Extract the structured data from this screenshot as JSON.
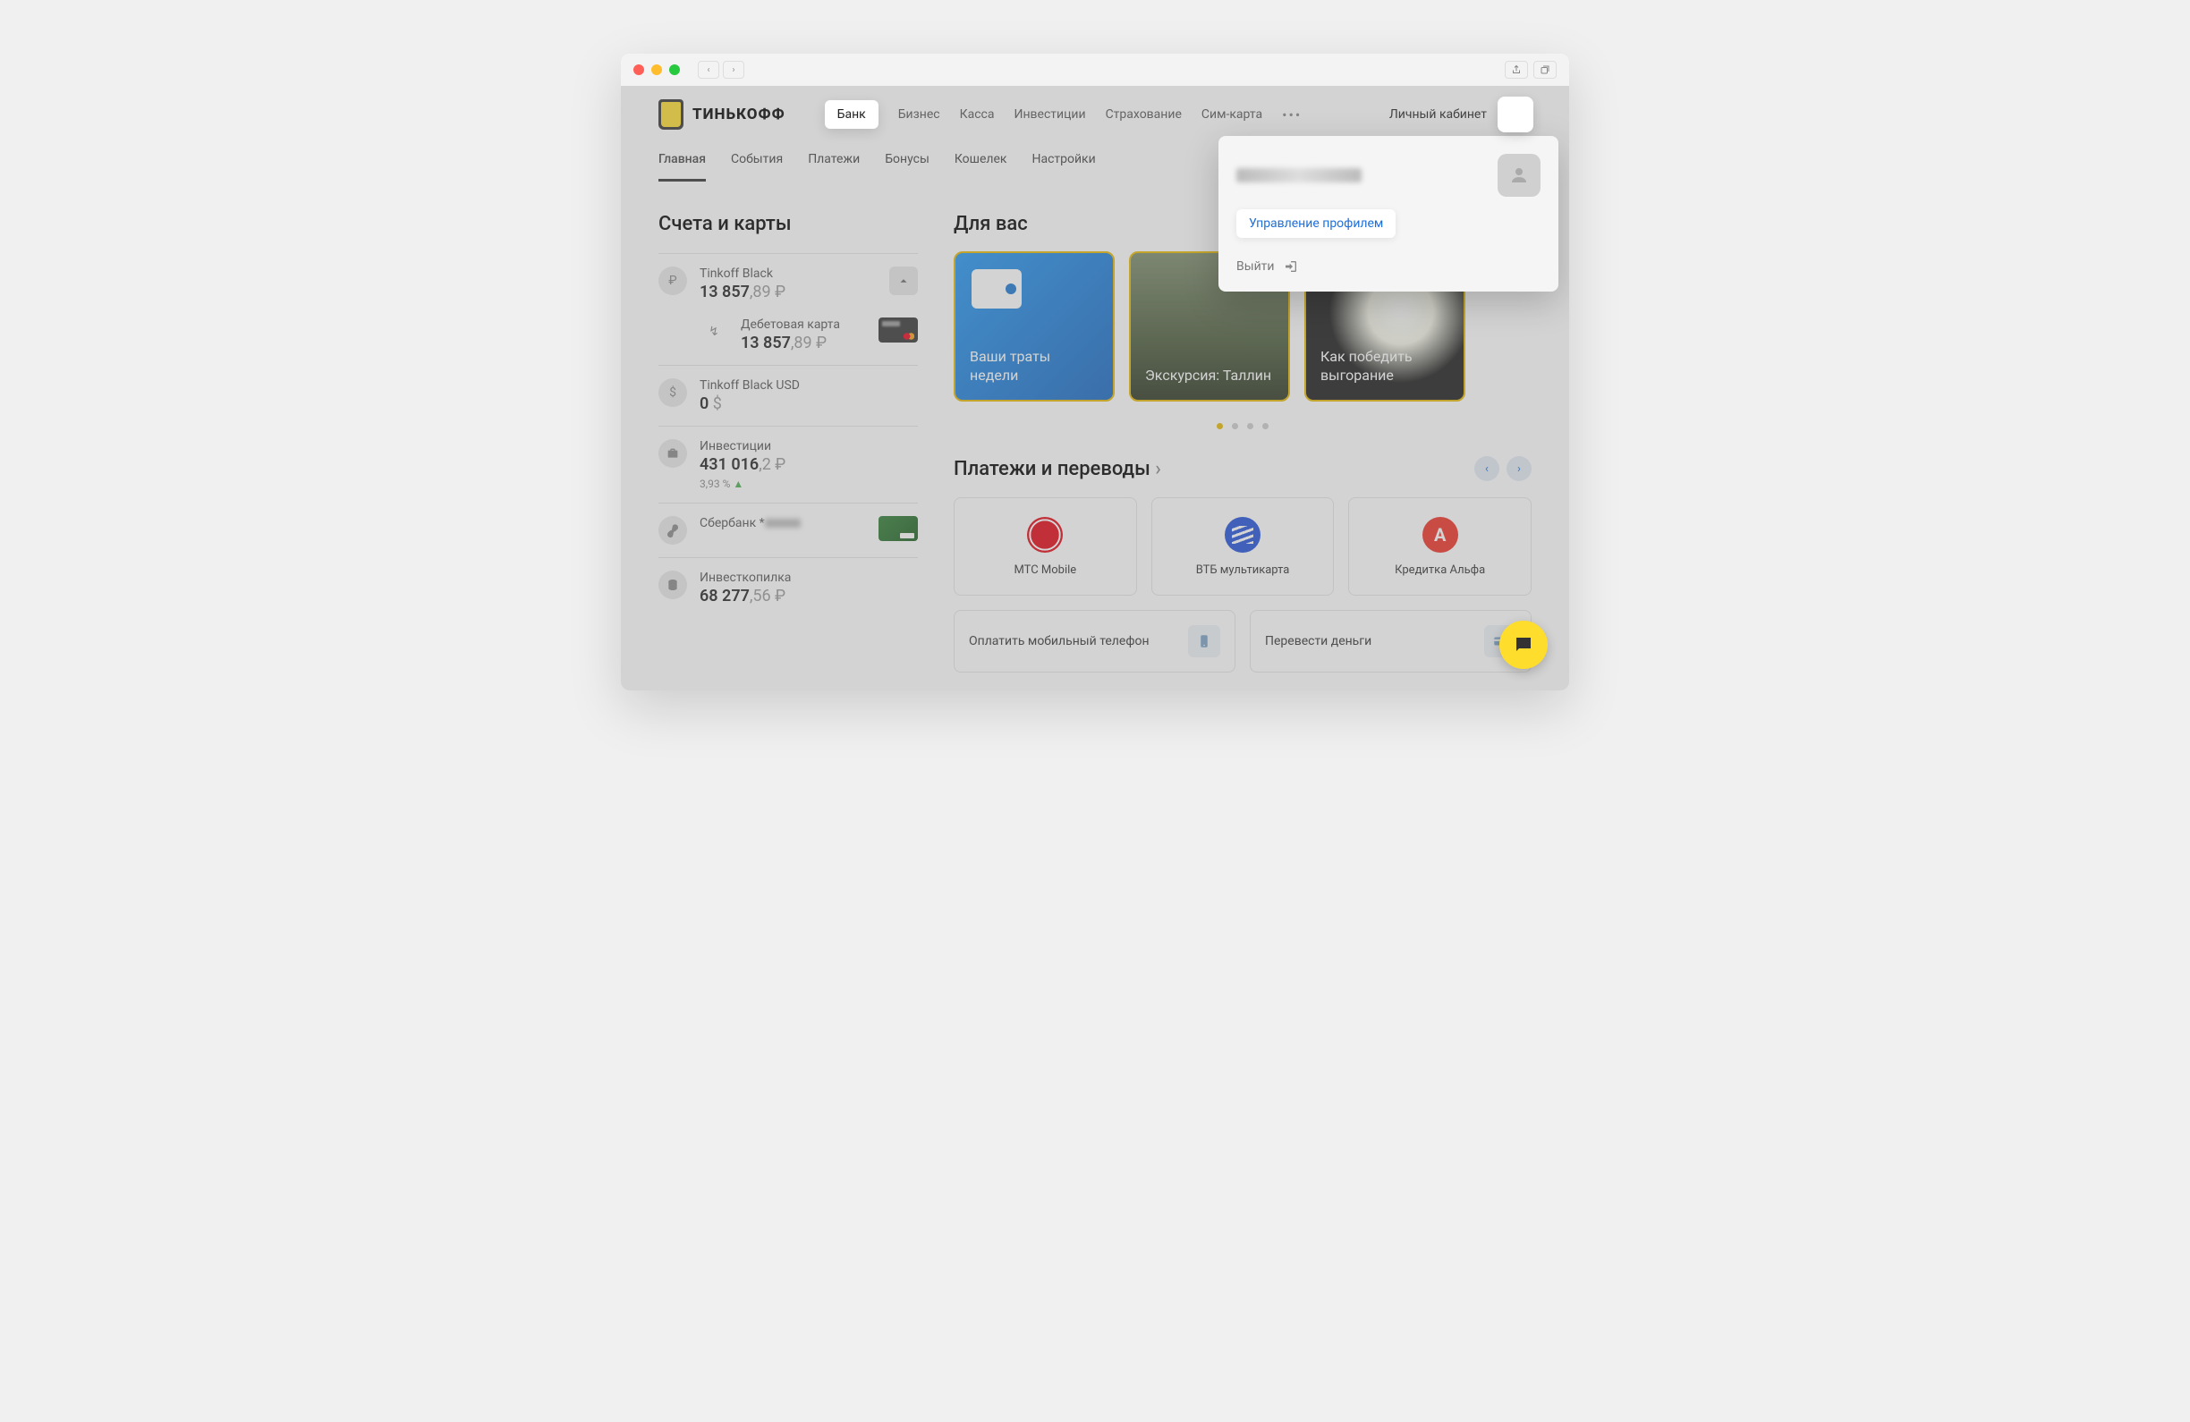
{
  "brand": "ТИНЬКОФФ",
  "top_nav": {
    "items": [
      "Банк",
      "Бизнес",
      "Касса",
      "Инвестиции",
      "Страхование",
      "Сим-карта"
    ],
    "active_index": 0
  },
  "cabinet_label": "Личный кабинет",
  "sub_nav": {
    "items": [
      "Главная",
      "События",
      "Платежи",
      "Бонусы",
      "Кошелек",
      "Настройки"
    ],
    "active_index": 0
  },
  "profile_menu": {
    "manage_label": "Управление профилем",
    "logout_label": "Выйти"
  },
  "sidebar": {
    "title": "Счета и карты",
    "accounts": [
      {
        "name": "Tinkoff Black",
        "amount_int": "13 857",
        "amount_cents": ",89 ₽",
        "icon": "₽",
        "has_collapse": true,
        "sub": {
          "name": "Дебетовая карта",
          "amount_int": "13 857",
          "amount_cents": ",89 ₽",
          "icon": "↯",
          "card_style": "black"
        }
      },
      {
        "name": "Tinkoff Black USD",
        "amount_int": "0",
        "amount_cents": " $",
        "icon": "$"
      },
      {
        "name": "Инвестиции",
        "amount_int": "431 016",
        "amount_cents": ",2 ₽",
        "icon": "briefcase",
        "growth": "3,93 %"
      },
      {
        "name": "Сбербанк *",
        "amount_int": "",
        "amount_cents": "",
        "icon": "link",
        "card_style": "visa",
        "masked_tail": true
      },
      {
        "name": "Инвесткопилка",
        "amount_int": "68 277",
        "amount_cents": ",56 ₽",
        "icon": "stack"
      }
    ]
  },
  "for_you": {
    "title": "Для вас",
    "cards": [
      {
        "title": "Ваши траты недели",
        "style": "blue"
      },
      {
        "title": "Экскурсия: Таллин",
        "style": "city"
      },
      {
        "title": "Как победить выгорание",
        "style": "flower"
      }
    ],
    "dot_count": 4,
    "dot_active": 0
  },
  "payments": {
    "title": "Платежи и переводы",
    "providers": [
      {
        "label": "МТС Mobile",
        "logo": "mts"
      },
      {
        "label": "ВТБ мультикарта",
        "logo": "vtb"
      },
      {
        "label": "Кредитка Альфа",
        "logo": "alfa",
        "glyph": "A"
      }
    ],
    "actions": [
      {
        "label": "Оплатить мобильный телефон",
        "icon": "phone"
      },
      {
        "label": "Перевести деньги",
        "icon": "card"
      }
    ]
  }
}
